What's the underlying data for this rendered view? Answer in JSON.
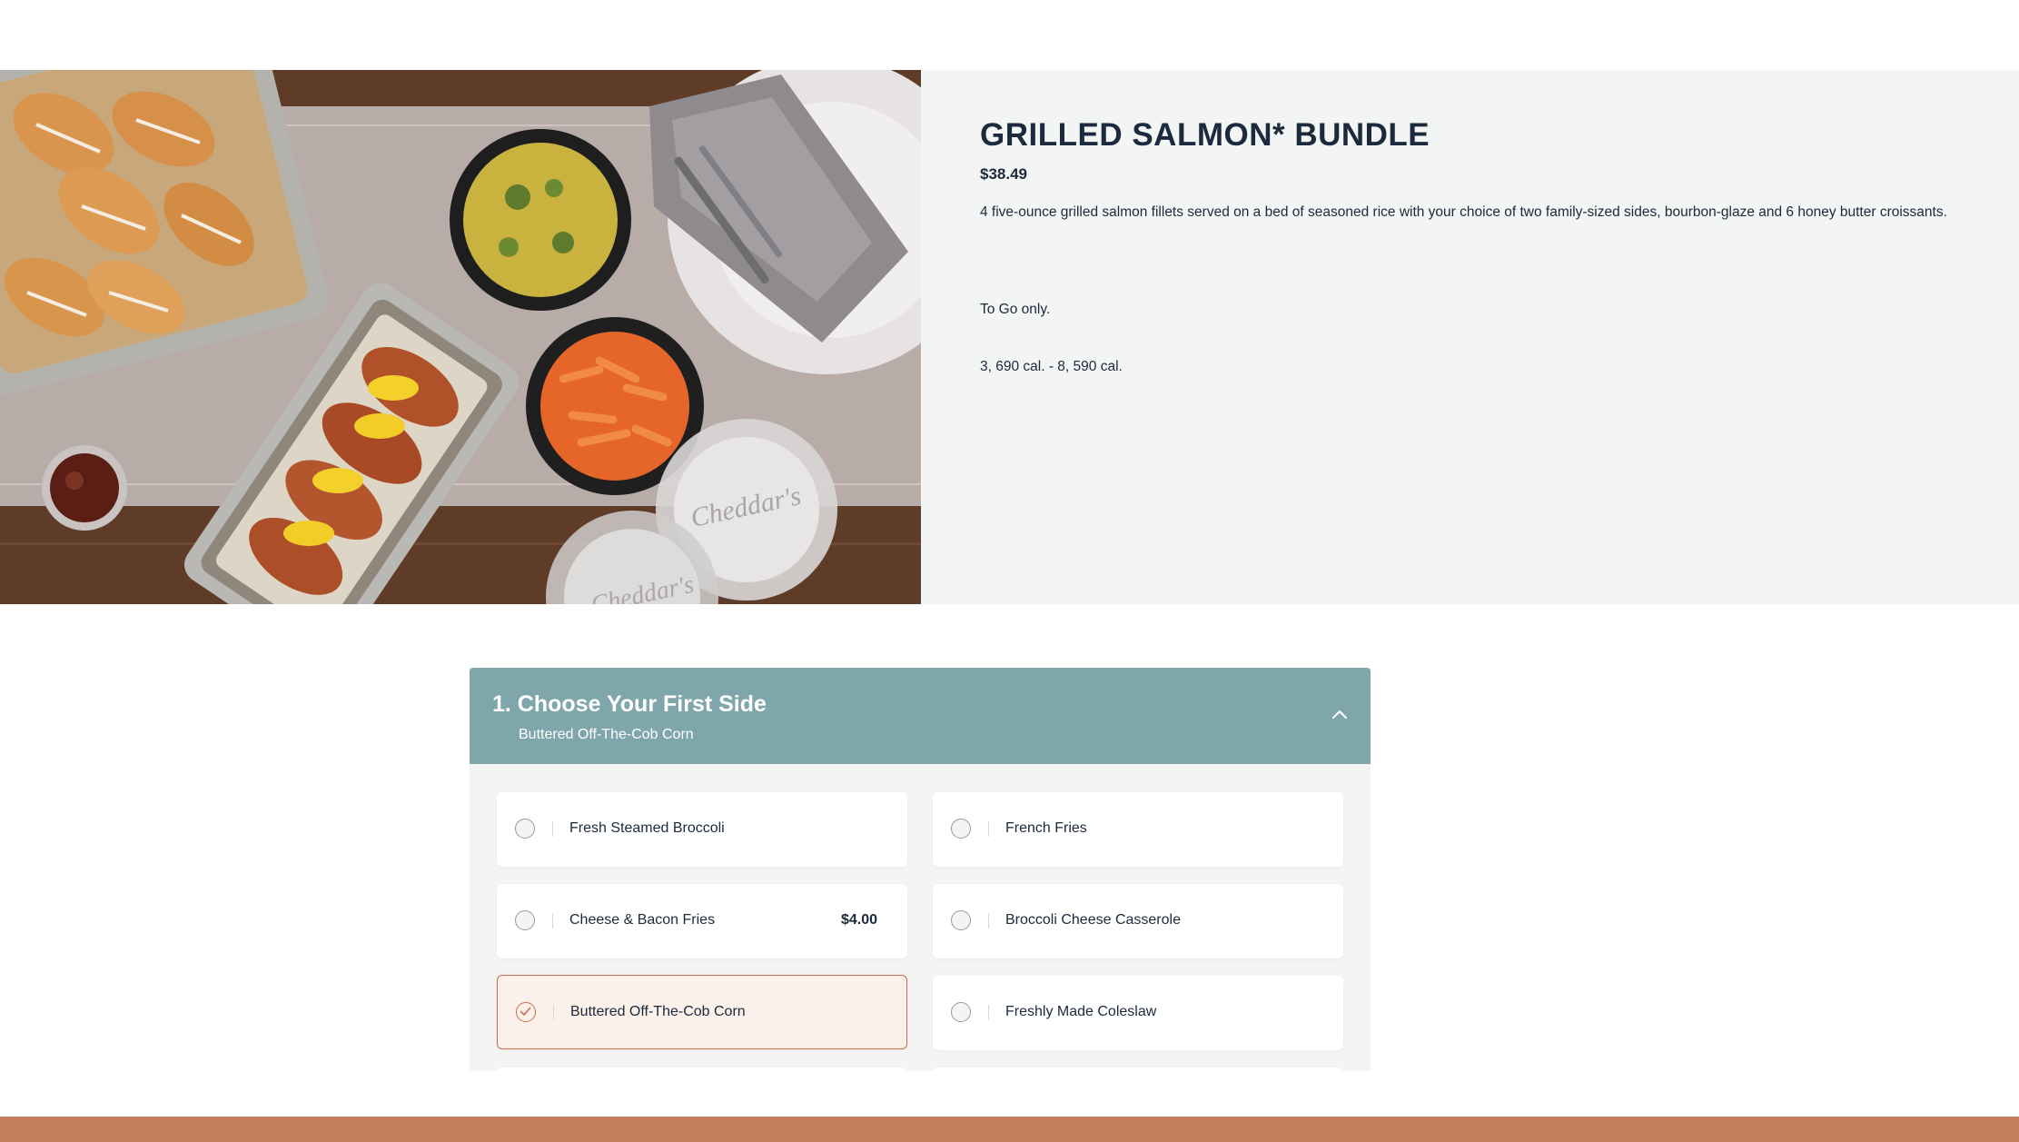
{
  "product": {
    "title": "GRILLED SALMON* BUNDLE",
    "price": "$38.49",
    "description": "4 five-ounce grilled salmon fillets served on a bed of seasoned rice with your choice of two family-sized sides, bourbon-glaze and 6 honey butter croissants.",
    "note": "To Go only.",
    "calories": "3, 690 cal. - 8, 590 cal."
  },
  "image": {
    "container_lid_text": "Cheddar's"
  },
  "side_section": {
    "title": "1. Choose Your First Side",
    "selected_summary": "Buttered Off-The-Cob Corn",
    "expanded_icon": "chevron-up-icon",
    "options": [
      {
        "label": "Fresh Steamed Broccoli",
        "price": "",
        "selected": false
      },
      {
        "label": "French Fries",
        "price": "",
        "selected": false
      },
      {
        "label": "Cheese & Bacon Fries",
        "price": "$4.00",
        "selected": false
      },
      {
        "label": "Broccoli Cheese Casserole",
        "price": "",
        "selected": false
      },
      {
        "label": "Buttered Off-The-Cob Corn",
        "price": "",
        "selected": true
      },
      {
        "label": "Freshly Made Coleslaw",
        "price": "",
        "selected": false
      }
    ]
  },
  "colors": {
    "accent_header": "#7ea6ab",
    "selected_border": "#c8704b",
    "footer_bar": "#c47e5c",
    "title_text": "#1b2a3c"
  }
}
